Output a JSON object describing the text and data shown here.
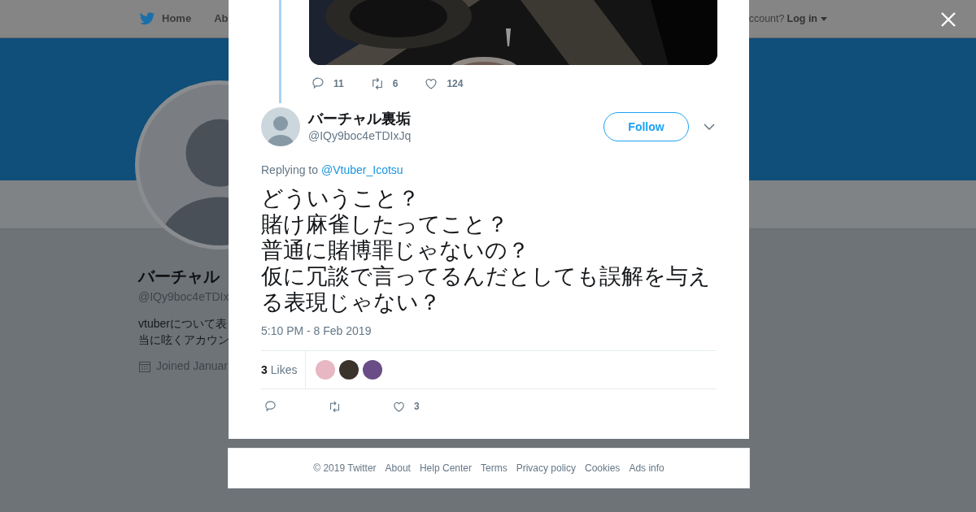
{
  "header": {
    "nav": [
      {
        "label": "Home"
      },
      {
        "label": "Ab"
      }
    ],
    "login_prompt": "ccount?",
    "login": "Log in"
  },
  "profile": {
    "name": "バーチャル",
    "handle": "@IQy9boc4eTDIx",
    "bio": [
      "vtuberについて表",
      "当に呟くアカウン"
    ],
    "joined": "Joined Januar"
  },
  "parent_tweet": {
    "actions": [
      {
        "kind": "reply",
        "count": "11"
      },
      {
        "kind": "retweet",
        "count": "6"
      },
      {
        "kind": "like",
        "count": "124"
      }
    ]
  },
  "tweet": {
    "name": "バーチャル裏垢",
    "handle": "@IQy9boc4eTDIxJq",
    "follow": "Follow",
    "replying_to": "Replying to",
    "reply_handle": "@Vtuber_Icotsu",
    "text_lines": [
      "どういうこと？",
      "賭け麻雀したってこと？",
      "普通に賭博罪じゃないの？",
      "仮に冗談で言ってるんだとしても誤解を与える表現じゃない？"
    ],
    "time": "5:10 PM - 8 Feb 2019",
    "likes": {
      "count": "3",
      "label": "Likes",
      "avatars": [
        {
          "color": "#e7b7c3"
        },
        {
          "color": "#3b342c"
        },
        {
          "color": "#6a4d86"
        }
      ]
    },
    "actions": [
      {
        "kind": "reply"
      },
      {
        "kind": "retweet"
      },
      {
        "kind": "like",
        "count": "3"
      }
    ]
  },
  "footer": [
    "© 2019 Twitter",
    "About",
    "Help Center",
    "Terms",
    "Privacy policy",
    "Cookies",
    "Ads info"
  ]
}
